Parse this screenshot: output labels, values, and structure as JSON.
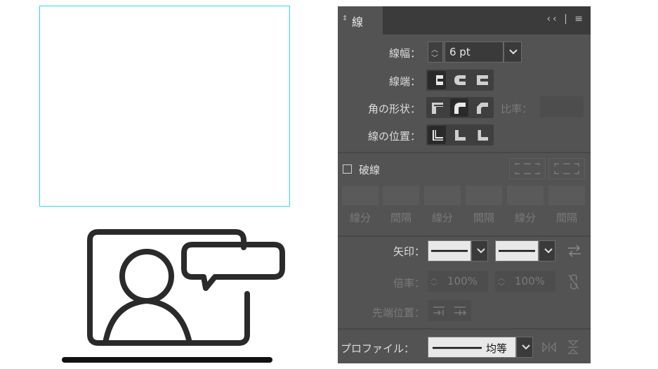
{
  "panel": {
    "title": "線",
    "weight": {
      "label": "線幅",
      "value": "6 pt"
    },
    "cap": {
      "label": "線端"
    },
    "corner": {
      "label": "角の形状",
      "ratio_label": "比率"
    },
    "align": {
      "label": "線の位置"
    },
    "dashed": {
      "label": "破線",
      "checked": false,
      "cols": [
        "線分",
        "間隔",
        "線分",
        "間隔",
        "線分",
        "間隔"
      ]
    },
    "arrows": {
      "label": "矢印"
    },
    "scale": {
      "label": "倍率",
      "start": "100%",
      "end": "100%"
    },
    "tip": {
      "label": "先端位置"
    },
    "profile": {
      "label": "プロファイル",
      "value": "均等"
    },
    "colon": "："
  },
  "colors": {
    "panel_bg": "#535353",
    "tab_bg": "#3b3b3b",
    "selection": "#3ad6e0",
    "icon": "#2a2a2a"
  },
  "icons": [
    "video-call-person-icon",
    "speech-bubble-icon"
  ]
}
